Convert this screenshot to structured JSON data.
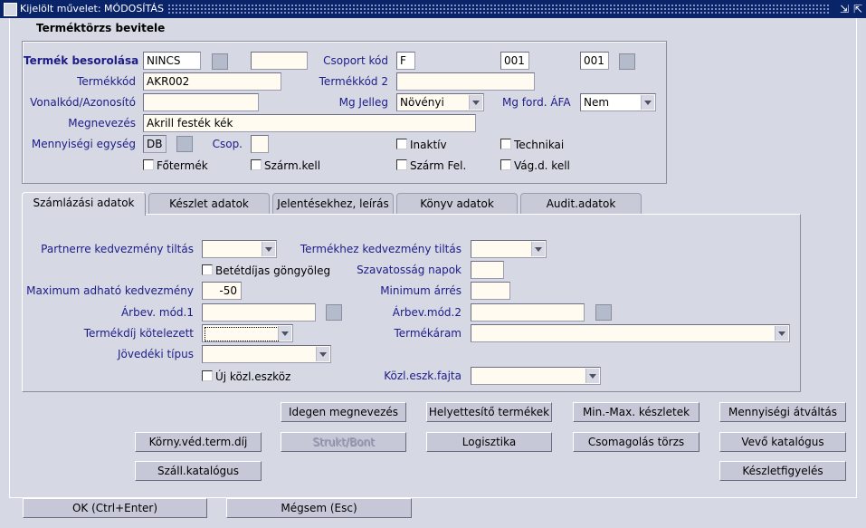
{
  "window": {
    "title": "Kijelölt művelet: MÓDOSÍTÁS"
  },
  "header": {
    "title": "Terméktörzs bevitele"
  },
  "top": {
    "besorolas_label": "Termék besorolása",
    "besorolas_value": "NINCS",
    "csoport_label": "Csoport kód",
    "csoport_value1": "F",
    "csoport_value2": "001",
    "csoport_value3": "001",
    "termekkod_label": "Termékkód",
    "termekkod_value": "AKR002",
    "termekkod2_label": "Termékkód 2",
    "termekkod2_value": "",
    "vonalkod_label": "Vonalkód/Azonosító",
    "vonalkod_value": "",
    "mgjelleg_label": "Mg Jelleg",
    "mgjelleg_value": "Növényi",
    "mgford_label": "Mg ford. ÁFA",
    "mgford_value": "Nem",
    "megnevezes_label": "Megnevezés",
    "megnevezes_value": "Akrill festék kék",
    "menny_label": "Mennyiségi egység",
    "menny_value": "DB",
    "csop_label": "Csop.",
    "csop_value": "",
    "inaktiv_label": "Inaktív",
    "technikai_label": "Technikai",
    "fotermek_label": "Főtermék",
    "szarm_kell_label": "Szárm.kell",
    "szarm_fel_label": "Szárm Fel.",
    "vagd_label": "Vág.d. kell"
  },
  "tabs": [
    {
      "label": "Számlázási adatok"
    },
    {
      "label": "Készlet adatok"
    },
    {
      "label": "Jelentésekhez, leírás"
    },
    {
      "label": "Könyv adatok"
    },
    {
      "label": "Audit.adatok"
    }
  ],
  "szamlazas": {
    "partner_label": "Partnerre kedvezmény tiltás",
    "termekhez_label": "Termékhez kedvezmény tiltás",
    "betetdijas_label": "Betétdíjas göngyöleg",
    "szavatossag_label": "Szavatosság napok",
    "maxkedv_label": "Maximum adható kedvezmény",
    "maxkedv_value": "-50",
    "minarres_label": "Minimum árrés",
    "arbev1_label": "Árbev. mód.1",
    "arbev2_label": "Árbev.mód.2",
    "termekdij_label": "Termékdíj kötelezett",
    "termekaram_label": "Termékáram",
    "jovedeki_label": "Jövedéki típus",
    "ujkozl_label": "Új közl.eszköz",
    "kozleszk_label": "Közl.eszk.fajta"
  },
  "buttons": {
    "idegen": "Idegen megnevezés",
    "helyettesito": "Helyettesítő termékek",
    "minmax": "Min.-Max. készletek",
    "mennyisegi": "Mennyiségi átváltás",
    "kornyved": "Körny.véd.term.díj",
    "strukt": "Strukt/Bont",
    "logisztika": "Logisztika",
    "csomagolas": "Csomagolás törzs",
    "vevo": "Vevő katalógus",
    "szall": "Száll.katalógus",
    "keszletfigyeles": "Készletfigyelés",
    "ok": "OK (Ctrl+Enter)",
    "megsem": "Mégsem (Esc)"
  }
}
